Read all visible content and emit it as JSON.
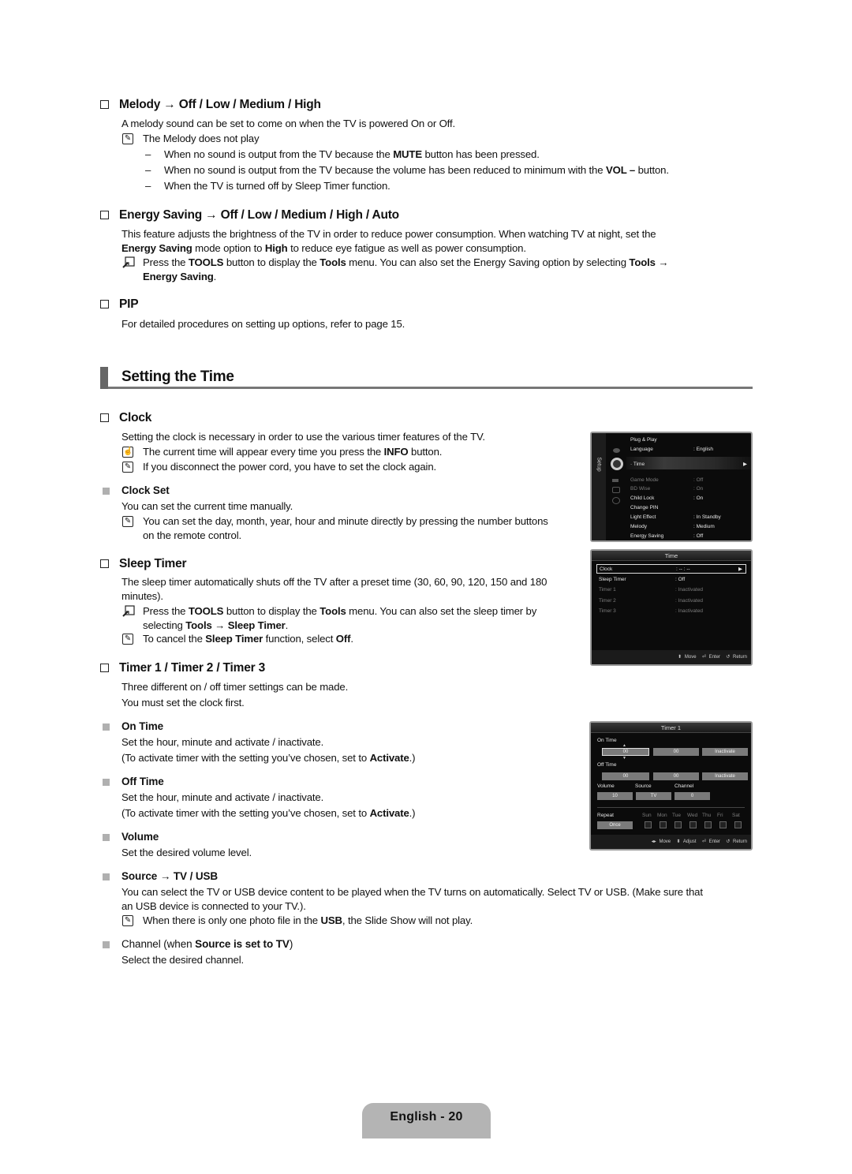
{
  "melody": {
    "heading": "Melody → Off / Low / Medium / High",
    "desc": "A melody sound can be set to come on when the TV is powered On or Off.",
    "note": "The Melody does not play",
    "bullets": [
      {
        "pre": "When no sound is output from the TV because the ",
        "bold": "MUTE",
        "post": " button has been pressed."
      },
      {
        "pre": "When no sound is output from the TV because the volume has been reduced to minimum with the ",
        "bold": "VOL –",
        "post": " button."
      },
      {
        "pre": "When the TV is turned off by Sleep Timer function.",
        "bold": "",
        "post": ""
      }
    ]
  },
  "energy": {
    "heading": "Energy Saving → Off / Low / Medium / High / Auto",
    "desc_1": "This feature adjusts the brightness of the TV in order to reduce power consumption. When watching TV at night, set the",
    "desc_2_bold_1": "Energy Saving",
    "desc_2_mid": " mode option to ",
    "desc_2_bold_2": "High",
    "desc_2_post": " to reduce eye fatigue as well as power consumption.",
    "tools_pre": "Press the ",
    "tools_b1": "TOOLS",
    "tools_mid1": " button to display the ",
    "tools_b2": "Tools",
    "tools_mid2": " menu. You can also set the Energy Saving option by selecting ",
    "tools_b3": "Tools →",
    "tools_b4": "Energy Saving",
    "tools_post": "."
  },
  "pip": {
    "heading": "PIP",
    "desc": "For detailed procedures on setting up options, refer to page 15."
  },
  "section_title": "Setting the Time",
  "clock": {
    "heading": "Clock",
    "desc": "Setting the clock is necessary in order to use the various timer features of the TV.",
    "info_pre": "The current time will appear every time you press the ",
    "info_bold": "INFO",
    "info_post": " button.",
    "note": "If you disconnect the power cord, you have to set the clock again.",
    "clock_set": {
      "heading": "Clock Set",
      "desc": "You can set the current time manually.",
      "note_1": "You can set the day, month, year, hour and minute directly by pressing the number buttons",
      "note_2": "on the remote control."
    }
  },
  "sleep": {
    "heading": "Sleep Timer",
    "desc_1": "The sleep timer automatically shuts off the TV after a preset time (30, 60, 90, 120, 150 and 180",
    "desc_2": "minutes).",
    "tools_pre": "Press the ",
    "tools_b1": "TOOLS",
    "tools_mid1": " button to display the ",
    "tools_b2": "Tools",
    "tools_mid2": " menu. You can also set the sleep timer by",
    "tools_l2_pre": "selecting ",
    "tools_l2_b1": "Tools",
    "tools_l2_arrow": " → ",
    "tools_l2_b2": "Sleep Timer",
    "tools_l2_post": ".",
    "note_pre": "To cancel the ",
    "note_b1": "Sleep Timer",
    "note_mid": " function, select ",
    "note_b2": "Off",
    "note_post": "."
  },
  "timers": {
    "heading": "Timer 1 / Timer 2 / Timer 3",
    "desc_1": "Three different on / off timer settings can be made.",
    "desc_2": "You must set the clock first.",
    "on_time": {
      "heading": "On Time",
      "desc": "Set the hour, minute and activate / inactivate.",
      "hint_pre": "(To activate timer with the setting you’ve chosen, set to ",
      "hint_bold": "Activate",
      "hint_post": ".)"
    },
    "off_time": {
      "heading": "Off Time",
      "desc": "Set the hour, minute and activate / inactivate.",
      "hint_pre": "(To activate timer with the setting you’ve chosen, set to ",
      "hint_bold": "Activate",
      "hint_post": ".)"
    },
    "volume": {
      "heading": "Volume",
      "desc": "Set the desired volume level."
    },
    "source": {
      "heading": "Source → TV / USB",
      "desc_1": "You can select the TV or USB device content to be played when the TV turns on automatically. Select TV or USB. (Make sure that",
      "desc_2": "an USB device is connected to your TV.).",
      "note_pre": "When there is only one photo file in the ",
      "note_bold": "USB",
      "note_post": ", the Slide Show will not play."
    },
    "channel": {
      "heading_pre": "Channel (when ",
      "heading_mid": "Source is set to TV",
      "heading_post": ")",
      "desc": "Select the desired channel."
    }
  },
  "osd_setup": {
    "side_label": "Setup",
    "items": [
      {
        "label": "Plug & Play",
        "value": "",
        "dim": false
      },
      {
        "label": "Language",
        "value": ": English",
        "dim": false
      },
      {
        "label": "· Time",
        "value": "",
        "dim": false
      },
      {
        "label": "Game Mode",
        "value": ": Off",
        "dim": true
      },
      {
        "label": "BD Wise",
        "value": ": On",
        "dim": true
      },
      {
        "label": "Child Lock",
        "value": ": On",
        "dim": false
      },
      {
        "label": "Change PIN",
        "value": "",
        "dim": false
      },
      {
        "label": "Light Effect",
        "value": ": In Standby",
        "dim": false
      },
      {
        "label": "Melody",
        "value": ": Medium",
        "dim": false
      },
      {
        "label": "Energy Saving",
        "value": ": Off",
        "dim": false
      }
    ]
  },
  "osd_time": {
    "title": "Time",
    "items": [
      {
        "label": "Clock",
        "value": ": -- : --"
      },
      {
        "label": "Sleep Timer",
        "value": ": Off"
      },
      {
        "label": "Timer 1",
        "value": ": Inactivated"
      },
      {
        "label": "Timer 2",
        "value": ": Inactivated"
      },
      {
        "label": "Timer 3",
        "value": ": Inactivated"
      }
    ],
    "footer": {
      "move": "Move",
      "enter": "Enter",
      "return": "Return"
    }
  },
  "osd_timer1": {
    "title": "Timer 1",
    "on_time_label": "On Time",
    "on_hour": "00",
    "on_minute": "00",
    "on_state": "Inactivate",
    "off_time_label": "Off Time",
    "off_hour": "00",
    "off_minute": "00",
    "off_state": "Inactivate",
    "volume_label": "Volume",
    "volume_value": "10",
    "source_label": "Source",
    "source_value": "TV",
    "channel_label": "Channel",
    "channel_value": "0",
    "repeat_label": "Repeat",
    "repeat_value": "Once",
    "days": [
      "Sun",
      "Mon",
      "Tue",
      "Wed",
      "Thu",
      "Fri",
      "Sat"
    ],
    "footer": {
      "move": "Move",
      "adjust": "Adjust",
      "enter": "Enter",
      "return": "Return"
    }
  },
  "footer": {
    "page_label": "English - 20"
  }
}
